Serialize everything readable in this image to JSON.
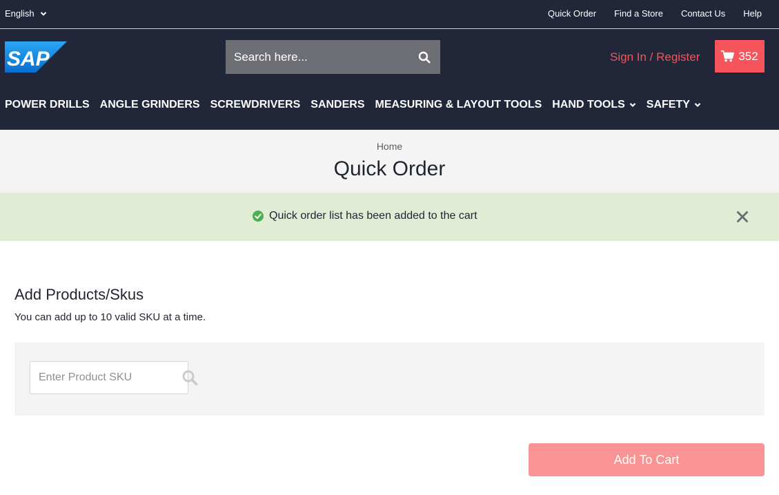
{
  "topbar": {
    "language": "English",
    "links": [
      "Quick Order",
      "Find a Store",
      "Contact Us",
      "Help"
    ]
  },
  "header": {
    "logo_text": "SAP",
    "search_placeholder": "Search here...",
    "signin_label": "Sign In / Register",
    "cart_count": "352"
  },
  "nav": {
    "items": [
      "POWER DRILLS",
      "ANGLE GRINDERS",
      "SCREWDRIVERS",
      "SANDERS",
      "MEASURING & LAYOUT TOOLS",
      "HAND TOOLS",
      "SAFETY"
    ]
  },
  "page": {
    "breadcrumb": "Home",
    "title": "Quick Order"
  },
  "alert": {
    "message": "Quick order list has been added to the cart"
  },
  "quick_order": {
    "section_title": "Add Products/Skus",
    "subtitle": "You can add up to 10 valid SKU at a time.",
    "sku_placeholder": "Enter Product SKU",
    "add_button": "Add To Cart"
  },
  "colors": {
    "header_bg": "#212738",
    "accent": "#f5555b",
    "alert_bg": "#e0ecd3",
    "success": "#4caf50"
  }
}
